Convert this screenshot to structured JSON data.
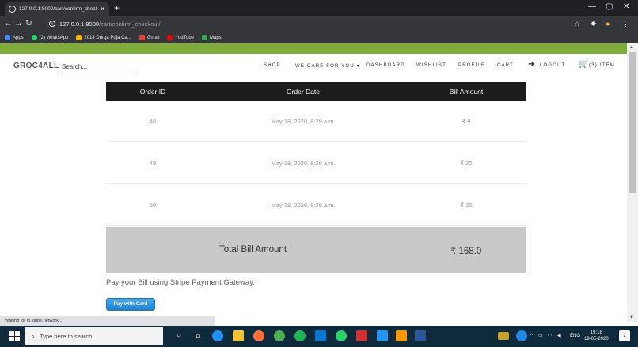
{
  "browser": {
    "tab_title": "127.0.0.1:8000/cart/confirm_check",
    "url_host": "127.0.0.1:8000",
    "url_path": "/cart/confirm_checkout/",
    "bookmarks": [
      {
        "label": "Apps",
        "icon": "apps-grid-icon",
        "color": "#4285f4"
      },
      {
        "label": "(2) WhatsApp",
        "icon": "whatsapp-icon",
        "color": "#25d366"
      },
      {
        "label": "2014 Durga Puja Ca...",
        "icon": "durga-puja-icon",
        "color": "#f4b400"
      },
      {
        "label": "Gmail",
        "icon": "gmail-icon",
        "color": "#ea4335"
      },
      {
        "label": "YouTube",
        "icon": "youtube-icon",
        "color": "#ff0000"
      },
      {
        "label": "Maps",
        "icon": "maps-icon",
        "color": "#34a853"
      }
    ],
    "status_text": "Waiting for m.stripe.network..."
  },
  "site": {
    "logo": "GROC4ALL",
    "search_placeholder": "Search...",
    "nav": {
      "shop": "SHOP",
      "we_care": "WE CARE FOR YOU",
      "dashboard": "DASHBOARD",
      "wishlist": "WISHLIST",
      "profile": "PROFILE",
      "cart": "CART",
      "logout": "LOGOUT",
      "cart_items": "(3) ITEM"
    },
    "accent_color": "#7fad39"
  },
  "orders": {
    "headers": [
      "Order ID",
      "Order Date",
      "Bill Amount"
    ],
    "rows": [
      {
        "id": "48",
        "date": "May 18, 2020, 8:29 a.m.",
        "amount": "₹ 8"
      },
      {
        "id": "49",
        "date": "May 18, 2020, 8:29 a.m.",
        "amount": "₹ 20"
      },
      {
        "id": "50",
        "date": "May 18, 2020, 8:29 a.m.",
        "amount": "₹ 20"
      }
    ],
    "total_label": "Total Bill Amount",
    "total_value": "₹ 168.0"
  },
  "payment": {
    "text": "Pay your Bill using Stripe Payment Gateway.",
    "button_label": "Pay with Card"
  },
  "taskbar": {
    "search_placeholder": "Type here to search",
    "lang": "ENG",
    "time": "19:18",
    "date": "19-05-2020",
    "notification_count": "2"
  }
}
